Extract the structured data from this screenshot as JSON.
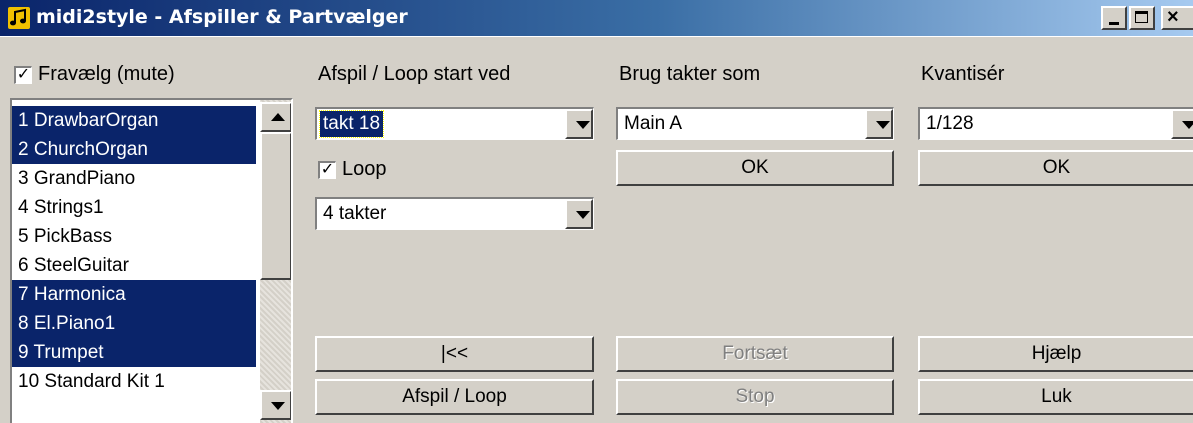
{
  "window": {
    "title": "midi2style - Afspiller & Partvælger",
    "controls": [
      "minimize-icon",
      "maximize-icon",
      "close-icon"
    ]
  },
  "mute": {
    "label": "Fravælg (mute)",
    "checked": true,
    "check_mark": "✓"
  },
  "parts": [
    {
      "label": "1 DrawbarOrgan",
      "selected": true
    },
    {
      "label": "2 ChurchOrgan",
      "selected": true
    },
    {
      "label": "3 GrandPiano",
      "selected": false
    },
    {
      "label": "4 Strings1",
      "selected": false
    },
    {
      "label": "5 PickBass",
      "selected": false
    },
    {
      "label": "6 SteelGuitar",
      "selected": false
    },
    {
      "label": "7 Harmonica",
      "selected": true
    },
    {
      "label": "8 El.Piano1",
      "selected": true
    },
    {
      "label": "9 Trumpet",
      "selected": true
    },
    {
      "label": "10 Standard Kit 1",
      "selected": false
    }
  ],
  "playback": {
    "start_label": "Afspil / Loop start ved",
    "start_value": "takt 18",
    "loop_label": "Loop",
    "loop_checked": true,
    "loop_check_mark": "✓",
    "loop_length_value": "4 takter",
    "rewind_label": "|<<",
    "play_label": "Afspil / Loop"
  },
  "use_bars": {
    "label": "Brug takter som",
    "value": "Main A",
    "ok_label": "OK",
    "continue_label": "Fortsæt",
    "continue_enabled": false,
    "stop_label": "Stop",
    "stop_enabled": false
  },
  "quantize": {
    "label": "Kvantisér",
    "value": "1/128",
    "ok_label": "OK",
    "help_label": "Hjælp",
    "close_label": "Luk"
  },
  "colors": {
    "face": "#d4d0c8",
    "selection": "#0a246a",
    "title_start": "#0a246a",
    "title_end": "#a6caf0"
  }
}
